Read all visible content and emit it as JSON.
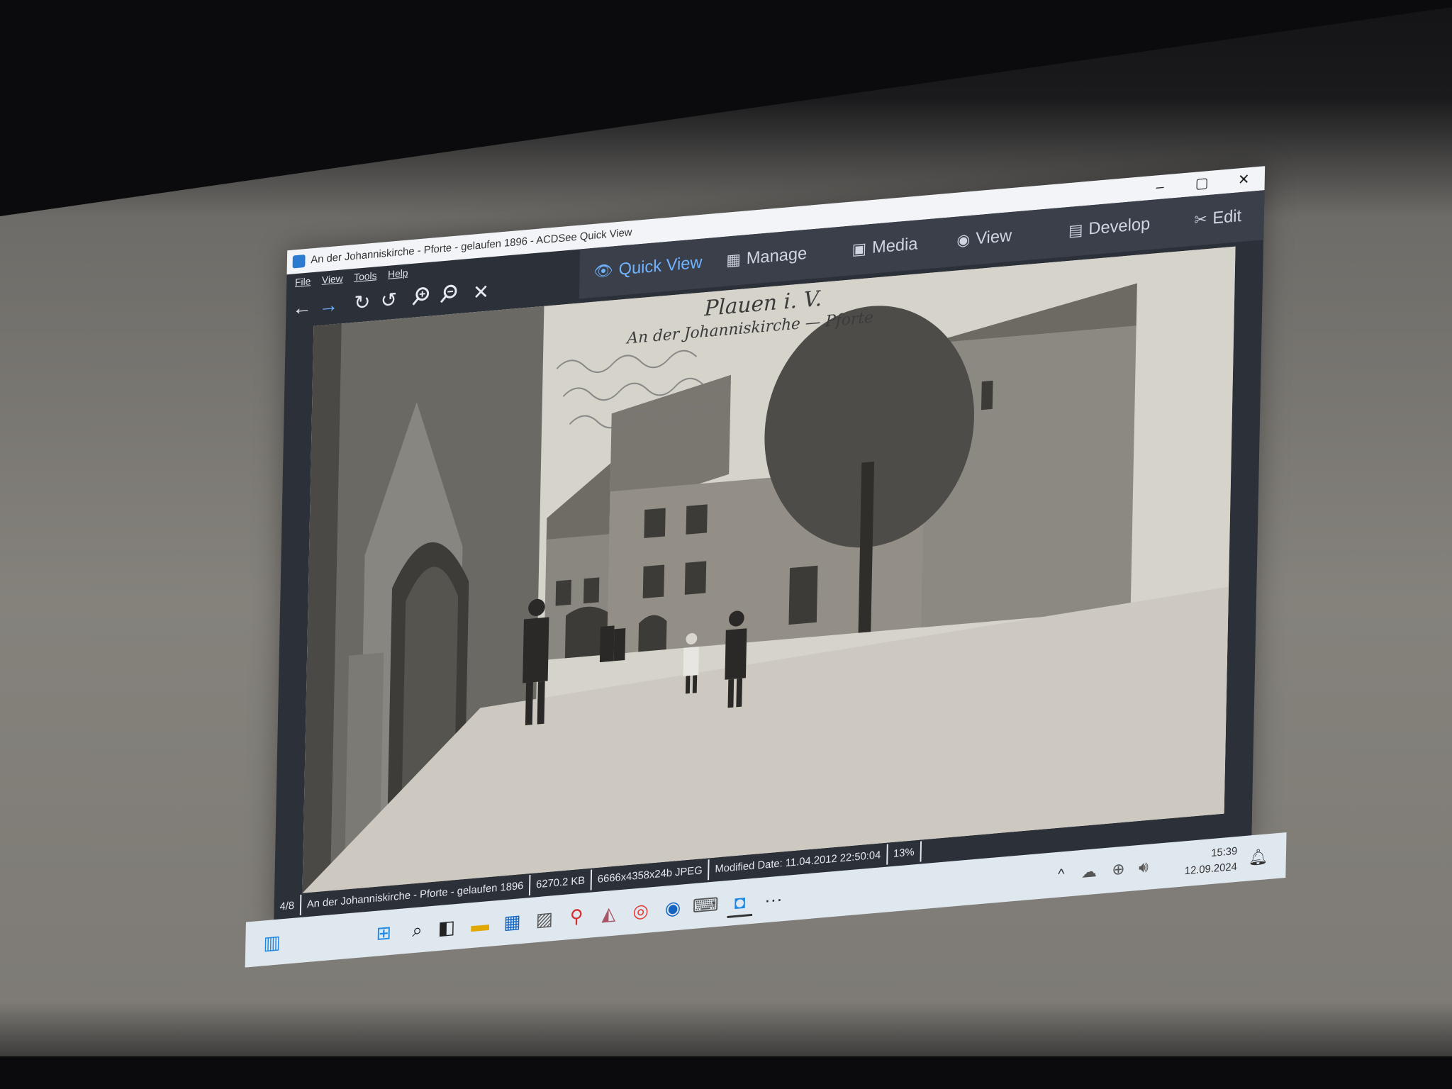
{
  "window": {
    "title": "An der Johanniskirche - Pforte - gelaufen 1896 - ACDSee Quick View",
    "minimize": "–",
    "maximize": "▢",
    "close": "✕"
  },
  "menu": [
    "File",
    "View",
    "Tools",
    "Help"
  ],
  "modes": {
    "quick_view": "Quick View",
    "manage": "Manage",
    "media": "Media",
    "view": "View",
    "develop": "Develop",
    "edit": "Edit"
  },
  "photo": {
    "caption_line1": "Plauen i. V.",
    "caption_line2": "An der Johanniskirche — Pforte"
  },
  "status": {
    "position": "4/8",
    "filename": "An der Johanniskirche - Pforte - gelaufen 1896",
    "filesize": "6270.2 KB",
    "dimensions": "6666x4358x24b JPEG",
    "modified": "Modified Date: 11.04.2012 22:50:04",
    "zoom": "13%"
  },
  "taskbar": {
    "time": "15:39",
    "date": "12.09.2024",
    "more": "···"
  },
  "icons": [
    "widgets-icon",
    "start-icon",
    "search-icon",
    "task-view-icon",
    "file-explorer-icon",
    "store-icon",
    "photo-icon",
    "magnifier-icon",
    "app-icon",
    "chrome-icon",
    "steam-icon",
    "keyboard-icon",
    "acdsee-icon",
    "chevron-up-icon",
    "cloud-icon",
    "network-icon",
    "volume-icon",
    "bell-icon"
  ],
  "colors": {
    "accent": "#6fb3ff",
    "window_bg": "#2c3039",
    "taskbar_bg": "#dfe7ef"
  }
}
